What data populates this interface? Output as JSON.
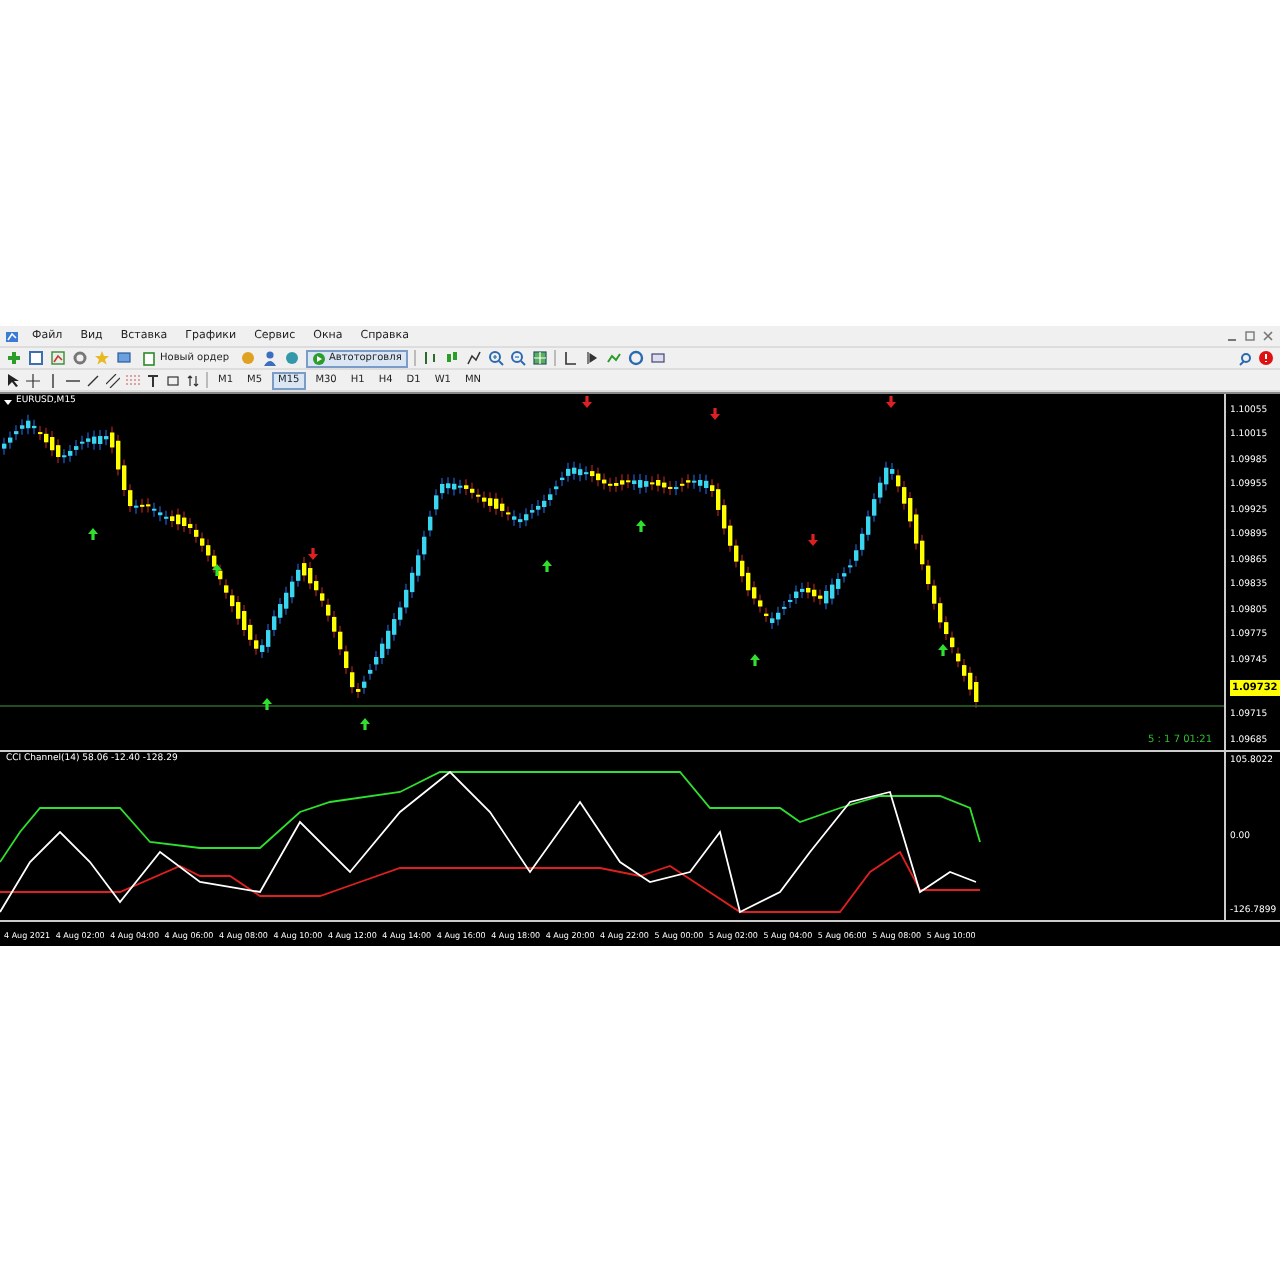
{
  "menu": [
    "Файл",
    "Вид",
    "Вставка",
    "Графики",
    "Сервис",
    "Окна",
    "Справка"
  ],
  "toolbar": {
    "new_order": "Новый ордер",
    "autotrading": "Автоторговля"
  },
  "timeframes": [
    {
      "label": "M1",
      "selected": false
    },
    {
      "label": "M5",
      "selected": false
    },
    {
      "label": "M15",
      "selected": true
    },
    {
      "label": "M30",
      "selected": false
    },
    {
      "label": "H1",
      "selected": false
    },
    {
      "label": "H4",
      "selected": false
    },
    {
      "label": "D1",
      "selected": false
    },
    {
      "label": "W1",
      "selected": false
    },
    {
      "label": "MN",
      "selected": false
    }
  ],
  "chart": {
    "title": "EURUSD,M15",
    "price_labels": [
      "1.10055",
      "1.10015",
      "1.09985",
      "1.09955",
      "1.09925",
      "1.09895",
      "1.09865",
      "1.09835",
      "1.09805",
      "1.09775",
      "1.09745",
      "1.09715",
      "1.09685"
    ],
    "current_price": "1.09732",
    "countdown": "5 : 1 7 01:21"
  },
  "indicator": {
    "title": "CCI Channel(14) 58.06 -12.40 -128.29",
    "scale_labels": [
      "105.8022",
      "0.00",
      "-126.7899"
    ]
  },
  "time_axis": [
    "4 Aug 2021",
    "4 Aug 02:00",
    "4 Aug 04:00",
    "4 Aug 06:00",
    "4 Aug 08:00",
    "4 Aug 10:00",
    "4 Aug 12:00",
    "4 Aug 14:00",
    "4 Aug 16:00",
    "4 Aug 18:00",
    "4 Aug 20:00",
    "4 Aug 22:00",
    "5 Aug 00:00",
    "5 Aug 02:00",
    "5 Aug 04:00",
    "5 Aug 06:00",
    "5 Aug 08:00",
    "5 Aug 10:00"
  ]
}
